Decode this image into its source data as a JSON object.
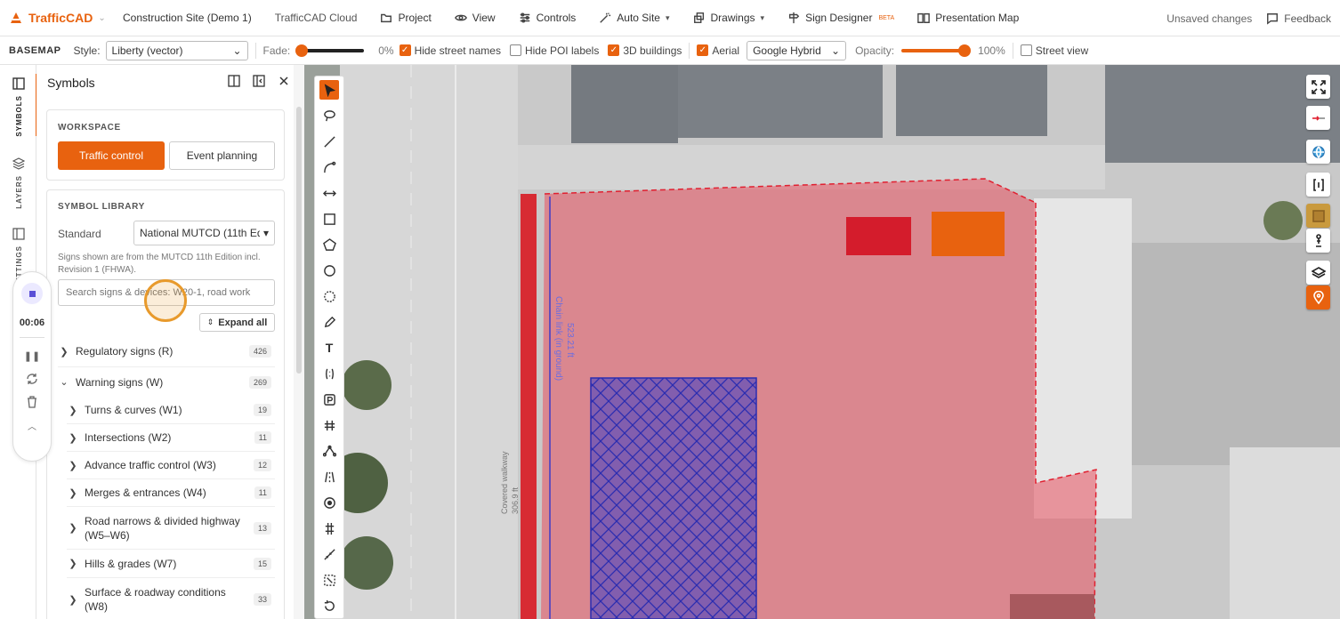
{
  "topbar": {
    "app_name": "TrafficCAD",
    "project_name": "Construction Site (Demo 1)",
    "cloud_label": "TrafficCAD Cloud",
    "menu": {
      "project": "Project",
      "view": "View",
      "controls": "Controls",
      "auto_site": "Auto Site",
      "drawings": "Drawings",
      "sign_designer": "Sign Designer",
      "sign_designer_badge": "BETA",
      "presentation_map": "Presentation Map"
    },
    "status": "Unsaved changes",
    "feedback": "Feedback"
  },
  "basemap": {
    "title": "BASEMAP",
    "style_label": "Style:",
    "style_value": "Liberty (vector)",
    "fade_label": "Fade:",
    "fade_percent": "0%",
    "fade_value": 0,
    "hide_street_names": "Hide street names",
    "hide_poi_labels": "Hide POI labels",
    "buildings_3d": "3D buildings",
    "aerial": "Aerial",
    "aerial_source": "Google Hybrid",
    "opacity_label": "Opacity:",
    "opacity_percent": "100%",
    "opacity_value": 100,
    "street_view": "Street view",
    "checks": {
      "hide_street_names": true,
      "hide_poi_labels": false,
      "buildings_3d": true,
      "aerial": true,
      "street_view": false
    }
  },
  "rail": {
    "symbols": "SYMBOLS",
    "layers": "LAYERS",
    "settings": "SETTINGS"
  },
  "recorder": {
    "time": "00:06"
  },
  "panel": {
    "title": "Symbols",
    "workspace_label": "WORKSPACE",
    "workspace_active": "Traffic control",
    "workspace_other": "Event planning",
    "library_label": "SYMBOL LIBRARY",
    "standard_label": "Standard",
    "standard_value": "National MUTCD (11th Edi",
    "library_note": "Signs shown are from the MUTCD 11th Edition incl. Revision 1 (FHWA).",
    "search_placeholder": "Search signs & devices: W20-1, road work",
    "expand_all": "Expand all",
    "categories": [
      {
        "label": "Regulatory signs (R)",
        "count": "426",
        "expanded": false
      },
      {
        "label": "Warning signs (W)",
        "count": "269",
        "expanded": true
      }
    ],
    "subcategories": [
      {
        "label": "Turns & curves (W1)",
        "count": "19"
      },
      {
        "label": "Intersections (W2)",
        "count": "11"
      },
      {
        "label": "Advance traffic control (W3)",
        "count": "12"
      },
      {
        "label": "Merges & entrances (W4)",
        "count": "11"
      },
      {
        "label": "Road narrows & divided highway (W5–W6)",
        "count": "13"
      },
      {
        "label": "Hills & grades (W7)",
        "count": "15"
      },
      {
        "label": "Surface & roadway conditions (W8)",
        "count": "33"
      }
    ]
  },
  "map": {
    "fence_label": "Chain link (in ground)",
    "fence_length": "523.21 ft",
    "walkway_label": "Covered walkway",
    "walkway_length": "306.9 ft",
    "colors": {
      "zone": "#e8505f",
      "hatch": "#3a3cc8",
      "fence": "#e02030",
      "accent": "#e8620f"
    }
  }
}
